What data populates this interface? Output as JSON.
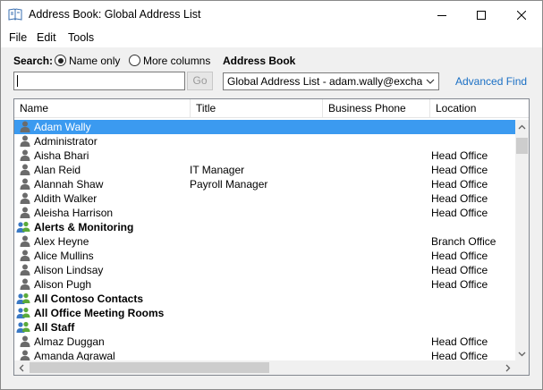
{
  "window": {
    "title": "Address Book: Global Address List"
  },
  "menu": [
    "File",
    "Edit",
    "Tools"
  ],
  "search": {
    "label": "Search:",
    "option_name_only": "Name only",
    "option_more_columns": "More columns",
    "value": "",
    "go_label": "Go"
  },
  "address_book": {
    "label": "Address Book",
    "selected": "Global Address List - adam.wally@exchange"
  },
  "advanced_find": "Advanced Find",
  "columns": [
    "Name",
    "Title",
    "Business Phone",
    "Location"
  ],
  "rows": [
    {
      "name": "Adam Wally",
      "title": "",
      "phone": "",
      "location": "",
      "type": "user",
      "selected": true
    },
    {
      "name": "Administrator",
      "title": "",
      "phone": "",
      "location": "",
      "type": "user"
    },
    {
      "name": "Aisha Bhari",
      "title": "",
      "phone": "",
      "location": "Head Office",
      "type": "user"
    },
    {
      "name": "Alan Reid",
      "title": "IT Manager",
      "phone": "",
      "location": "Head Office",
      "type": "user"
    },
    {
      "name": "Alannah Shaw",
      "title": "Payroll Manager",
      "phone": "",
      "location": "Head Office",
      "type": "user"
    },
    {
      "name": "Aldith Walker",
      "title": "",
      "phone": "",
      "location": "Head Office",
      "type": "user"
    },
    {
      "name": "Aleisha Harrison",
      "title": "",
      "phone": "",
      "location": "Head Office",
      "type": "user"
    },
    {
      "name": "Alerts & Monitoring",
      "title": "",
      "phone": "",
      "location": "",
      "type": "group"
    },
    {
      "name": "Alex Heyne",
      "title": "",
      "phone": "",
      "location": "Branch Office",
      "type": "user"
    },
    {
      "name": "Alice Mullins",
      "title": "",
      "phone": "",
      "location": "Head Office",
      "type": "user"
    },
    {
      "name": "Alison Lindsay",
      "title": "",
      "phone": "",
      "location": "Head Office",
      "type": "user"
    },
    {
      "name": "Alison Pugh",
      "title": "",
      "phone": "",
      "location": "Head Office",
      "type": "user"
    },
    {
      "name": "All Contoso Contacts",
      "title": "",
      "phone": "",
      "location": "",
      "type": "group"
    },
    {
      "name": "All Office Meeting Rooms",
      "title": "",
      "phone": "",
      "location": "",
      "type": "group"
    },
    {
      "name": "All Staff",
      "title": "",
      "phone": "",
      "location": "",
      "type": "group"
    },
    {
      "name": "Almaz Duggan",
      "title": "",
      "phone": "",
      "location": "Head Office",
      "type": "user"
    },
    {
      "name": "Amanda Agrawal",
      "title": "",
      "phone": "",
      "location": "Head Office",
      "type": "user"
    }
  ],
  "icons": {
    "user": "user-icon",
    "group": "group-icon",
    "app": "address-book-icon"
  },
  "colors": {
    "selection": "#3b9af0",
    "link": "#1a6fc4"
  }
}
